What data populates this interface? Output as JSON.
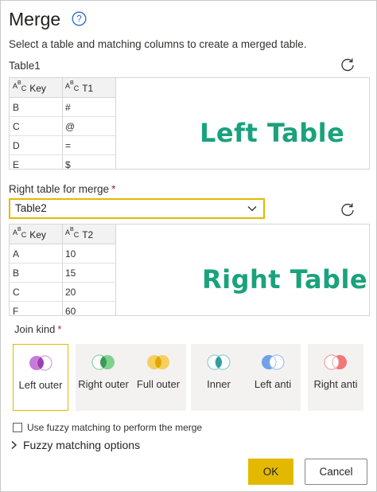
{
  "dialog": {
    "title": "Merge",
    "subtitle": "Select a table and matching columns to create a merged table."
  },
  "left_table": {
    "name": "Table1",
    "columns": [
      "Key",
      "T1"
    ],
    "rows": [
      [
        "B",
        "#"
      ],
      [
        "C",
        "@"
      ],
      [
        "D",
        "="
      ],
      [
        "E",
        "$"
      ]
    ],
    "overlay_label": "Left Table"
  },
  "right_table": {
    "label": "Right table for merge",
    "required_mark": "*",
    "selected": "Table2",
    "columns": [
      "Key",
      "T2"
    ],
    "rows": [
      [
        "A",
        "10"
      ],
      [
        "B",
        "15"
      ],
      [
        "C",
        "20"
      ],
      [
        "F",
        "60"
      ]
    ],
    "overlay_label": "Right Table"
  },
  "join_kind": {
    "label": "Join kind",
    "required_mark": "*",
    "options": [
      {
        "label": "Left outer",
        "selected": true,
        "icon": "venn-left-outer-icon"
      },
      {
        "label": "Right outer",
        "selected": false,
        "icon": "venn-right-outer-icon"
      },
      {
        "label": "Full outer",
        "selected": false,
        "icon": "venn-full-outer-icon"
      },
      {
        "label": "Inner",
        "selected": false,
        "icon": "venn-inner-icon"
      },
      {
        "label": "Left anti",
        "selected": false,
        "icon": "venn-left-anti-icon"
      },
      {
        "label": "Right anti",
        "selected": false,
        "icon": "venn-right-anti-icon"
      }
    ]
  },
  "fuzzy": {
    "checkbox_label": "Use fuzzy matching to perform the merge",
    "checked": false,
    "options_label": "Fuzzy matching options"
  },
  "buttons": {
    "ok": "OK",
    "cancel": "Cancel"
  },
  "colors": {
    "accent": "#e3b900",
    "overlay_text": "#1aa27c",
    "required": "#a4262c"
  }
}
